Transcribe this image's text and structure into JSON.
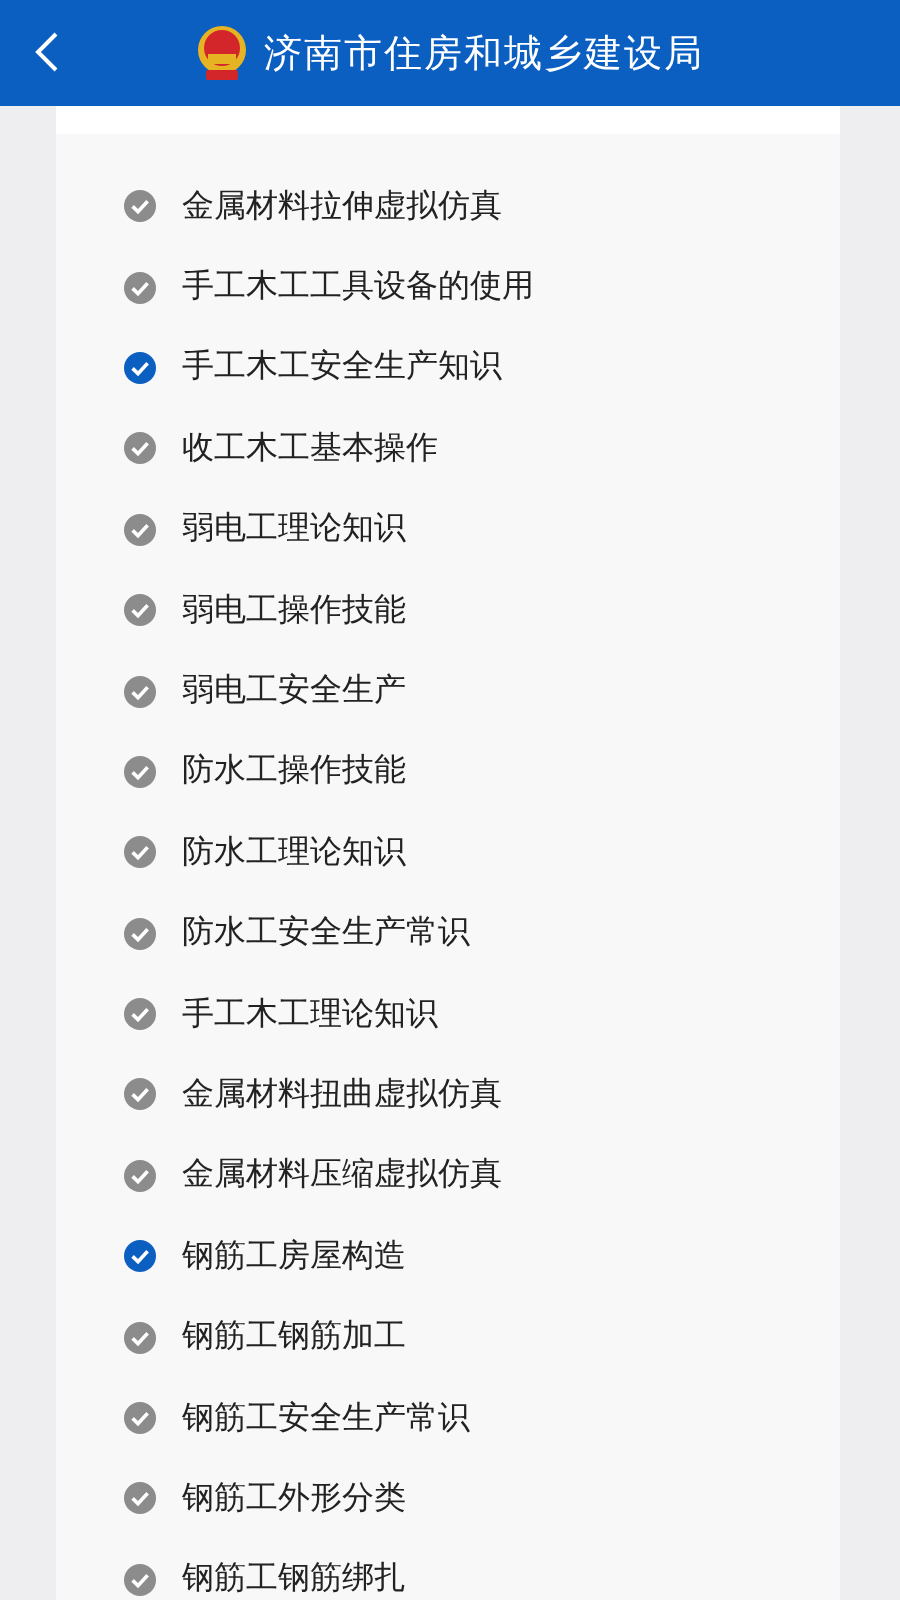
{
  "header": {
    "title": "济南市住房和城乡建设局"
  },
  "courses": [
    {
      "title": "金属材料拉伸虚拟仿真",
      "checked": false
    },
    {
      "title": "手工木工工具设备的使用",
      "checked": false
    },
    {
      "title": "手工木工安全生产知识",
      "checked": true
    },
    {
      "title": "收工木工基本操作",
      "checked": false
    },
    {
      "title": "弱电工理论知识",
      "checked": false
    },
    {
      "title": "弱电工操作技能",
      "checked": false
    },
    {
      "title": "弱电工安全生产",
      "checked": false
    },
    {
      "title": "防水工操作技能",
      "checked": false
    },
    {
      "title": "防水工理论知识",
      "checked": false
    },
    {
      "title": "防水工安全生产常识",
      "checked": false
    },
    {
      "title": "手工木工理论知识",
      "checked": false
    },
    {
      "title": "金属材料扭曲虚拟仿真",
      "checked": false
    },
    {
      "title": "金属材料压缩虚拟仿真",
      "checked": false
    },
    {
      "title": "钢筋工房屋构造",
      "checked": true
    },
    {
      "title": "钢筋工钢筋加工",
      "checked": false
    },
    {
      "title": "钢筋工安全生产常识",
      "checked": false
    },
    {
      "title": "钢筋工外形分类",
      "checked": false
    },
    {
      "title": "钢筋工钢筋绑扎",
      "checked": false
    }
  ]
}
